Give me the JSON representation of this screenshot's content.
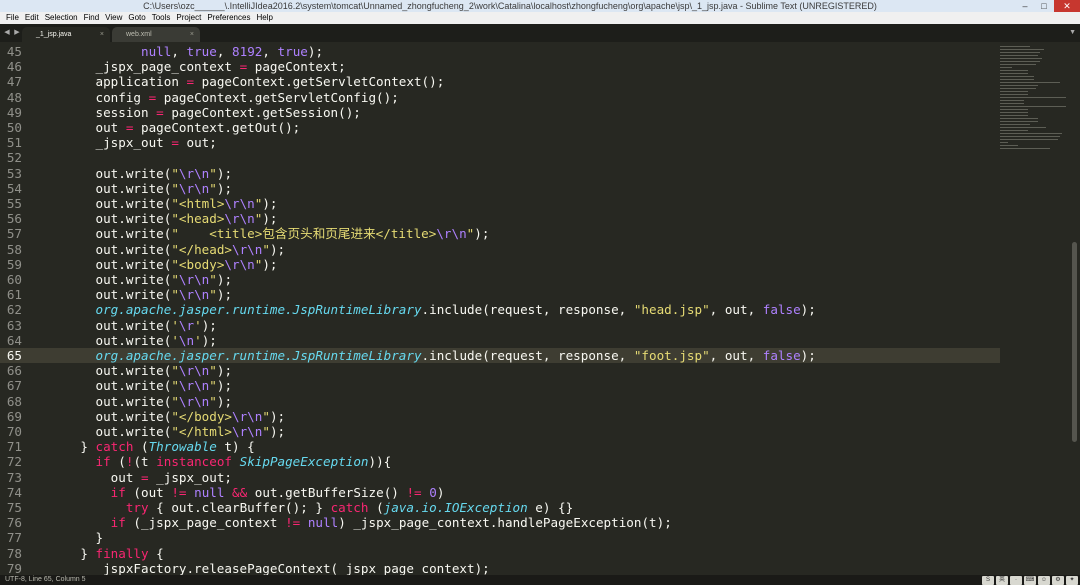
{
  "window": {
    "title": "C:\\Users\\ozc______\\.IntelliJIdea2016.2\\system\\tomcat\\Unnamed_zhongfucheng_2\\work\\Catalina\\localhost\\zhongfucheng\\org\\apache\\jsp\\_1_jsp.java - Sublime Text (UNREGISTERED)",
    "controls": {
      "minimize": "–",
      "maximize": "□",
      "close": "✕"
    }
  },
  "menu": [
    "File",
    "Edit",
    "Selection",
    "Find",
    "View",
    "Goto",
    "Tools",
    "Project",
    "Preferences",
    "Help"
  ],
  "tabs": [
    {
      "label": "_1_jsp.java",
      "active": true,
      "close": "×"
    },
    {
      "label": "web.xml",
      "active": false,
      "close": "×"
    }
  ],
  "nav": {
    "left": "◀",
    "right": "▶",
    "drop": "▼"
  },
  "editor": {
    "current_line": "65",
    "lines": [
      {
        "n": "45",
        "tokens": [
          [
            "",
            "            "
          ],
          [
            "c",
            "null"
          ],
          [
            "",
            ", "
          ],
          [
            "c",
            "true"
          ],
          [
            "",
            ", "
          ],
          [
            "c",
            "8192"
          ],
          [
            "",
            ", "
          ],
          [
            "c",
            "true"
          ],
          [
            "",
            ");"
          ]
        ]
      },
      {
        "n": "46",
        "tokens": [
          [
            "",
            "      _jspx_page_context "
          ],
          [
            "k",
            "="
          ],
          [
            "",
            " pageContext;"
          ]
        ]
      },
      {
        "n": "47",
        "tokens": [
          [
            "",
            "      application "
          ],
          [
            "k",
            "="
          ],
          [
            "",
            " pageContext.getServletContext();"
          ]
        ]
      },
      {
        "n": "48",
        "tokens": [
          [
            "",
            "      config "
          ],
          [
            "k",
            "="
          ],
          [
            "",
            " pageContext.getServletConfig();"
          ]
        ]
      },
      {
        "n": "49",
        "tokens": [
          [
            "",
            "      session "
          ],
          [
            "k",
            "="
          ],
          [
            "",
            " pageContext.getSession();"
          ]
        ]
      },
      {
        "n": "50",
        "tokens": [
          [
            "",
            "      out "
          ],
          [
            "k",
            "="
          ],
          [
            "",
            " pageContext.getOut();"
          ]
        ]
      },
      {
        "n": "51",
        "tokens": [
          [
            "",
            "      _jspx_out "
          ],
          [
            "k",
            "="
          ],
          [
            "",
            " out;"
          ]
        ]
      },
      {
        "n": "52",
        "tokens": [
          [
            "",
            ""
          ]
        ]
      },
      {
        "n": "53",
        "tokens": [
          [
            "",
            "      out.write("
          ],
          [
            "s",
            "\""
          ],
          [
            "e",
            "\\r\\n"
          ],
          [
            "s",
            "\""
          ],
          [
            "",
            ");"
          ]
        ]
      },
      {
        "n": "54",
        "tokens": [
          [
            "",
            "      out.write("
          ],
          [
            "s",
            "\""
          ],
          [
            "e",
            "\\r\\n"
          ],
          [
            "s",
            "\""
          ],
          [
            "",
            ");"
          ]
        ]
      },
      {
        "n": "55",
        "tokens": [
          [
            "",
            "      out.write("
          ],
          [
            "s",
            "\"<html>"
          ],
          [
            "e",
            "\\r\\n"
          ],
          [
            "s",
            "\""
          ],
          [
            "",
            ");"
          ]
        ]
      },
      {
        "n": "56",
        "tokens": [
          [
            "",
            "      out.write("
          ],
          [
            "s",
            "\"<head>"
          ],
          [
            "e",
            "\\r\\n"
          ],
          [
            "s",
            "\""
          ],
          [
            "",
            ");"
          ]
        ]
      },
      {
        "n": "57",
        "tokens": [
          [
            "",
            "      out.write("
          ],
          [
            "s",
            "\"    <title>包含页头和页尾进来</title>"
          ],
          [
            "e",
            "\\r\\n"
          ],
          [
            "s",
            "\""
          ],
          [
            "",
            ");"
          ]
        ]
      },
      {
        "n": "58",
        "tokens": [
          [
            "",
            "      out.write("
          ],
          [
            "s",
            "\"</head>"
          ],
          [
            "e",
            "\\r\\n"
          ],
          [
            "s",
            "\""
          ],
          [
            "",
            ");"
          ]
        ]
      },
      {
        "n": "59",
        "tokens": [
          [
            "",
            "      out.write("
          ],
          [
            "s",
            "\"<body>"
          ],
          [
            "e",
            "\\r\\n"
          ],
          [
            "s",
            "\""
          ],
          [
            "",
            ");"
          ]
        ]
      },
      {
        "n": "60",
        "tokens": [
          [
            "",
            "      out.write("
          ],
          [
            "s",
            "\""
          ],
          [
            "e",
            "\\r\\n"
          ],
          [
            "s",
            "\""
          ],
          [
            "",
            ");"
          ]
        ]
      },
      {
        "n": "61",
        "tokens": [
          [
            "",
            "      out.write("
          ],
          [
            "s",
            "\""
          ],
          [
            "e",
            "\\r\\n"
          ],
          [
            "s",
            "\""
          ],
          [
            "",
            ");"
          ]
        ]
      },
      {
        "n": "62",
        "tokens": [
          [
            "",
            "      "
          ],
          [
            "t",
            "org.apache.jasper.runtime.JspRuntimeLibrary"
          ],
          [
            "",
            ".include(request, response, "
          ],
          [
            "s",
            "\"head.jsp\""
          ],
          [
            "",
            ", out, "
          ],
          [
            "c",
            "false"
          ],
          [
            "",
            ");"
          ]
        ]
      },
      {
        "n": "63",
        "tokens": [
          [
            "",
            "      out.write("
          ],
          [
            "s",
            "'"
          ],
          [
            "e",
            "\\r"
          ],
          [
            "s",
            "'"
          ],
          [
            "",
            ");"
          ]
        ]
      },
      {
        "n": "64",
        "tokens": [
          [
            "",
            "      out.write("
          ],
          [
            "s",
            "'"
          ],
          [
            "e",
            "\\n"
          ],
          [
            "s",
            "'"
          ],
          [
            "",
            ");"
          ]
        ]
      },
      {
        "n": "65",
        "tokens": [
          [
            "",
            "      "
          ],
          [
            "t",
            "org.apache.jasper.runtime.JspRuntimeLibrary"
          ],
          [
            "",
            ".include(request, response, "
          ],
          [
            "s",
            "\"foot.jsp\""
          ],
          [
            "",
            ", out, "
          ],
          [
            "c",
            "false"
          ],
          [
            "",
            ");"
          ]
        ]
      },
      {
        "n": "66",
        "tokens": [
          [
            "",
            "      out.write("
          ],
          [
            "s",
            "\""
          ],
          [
            "e",
            "\\r\\n"
          ],
          [
            "s",
            "\""
          ],
          [
            "",
            ");"
          ]
        ]
      },
      {
        "n": "67",
        "tokens": [
          [
            "",
            "      out.write("
          ],
          [
            "s",
            "\""
          ],
          [
            "e",
            "\\r\\n"
          ],
          [
            "s",
            "\""
          ],
          [
            "",
            ");"
          ]
        ]
      },
      {
        "n": "68",
        "tokens": [
          [
            "",
            "      out.write("
          ],
          [
            "s",
            "\""
          ],
          [
            "e",
            "\\r\\n"
          ],
          [
            "s",
            "\""
          ],
          [
            "",
            ");"
          ]
        ]
      },
      {
        "n": "69",
        "tokens": [
          [
            "",
            "      out.write("
          ],
          [
            "s",
            "\"</body>"
          ],
          [
            "e",
            "\\r\\n"
          ],
          [
            "s",
            "\""
          ],
          [
            "",
            ");"
          ]
        ]
      },
      {
        "n": "70",
        "tokens": [
          [
            "",
            "      out.write("
          ],
          [
            "s",
            "\"</html>"
          ],
          [
            "e",
            "\\r\\n"
          ],
          [
            "s",
            "\""
          ],
          [
            "",
            ");"
          ]
        ]
      },
      {
        "n": "71",
        "tokens": [
          [
            "",
            "    } "
          ],
          [
            "k",
            "catch"
          ],
          [
            "",
            " ("
          ],
          [
            "t",
            "Throwable"
          ],
          [
            "",
            " t) {"
          ]
        ]
      },
      {
        "n": "72",
        "tokens": [
          [
            "",
            "      "
          ],
          [
            "k",
            "if"
          ],
          [
            "",
            " ("
          ],
          [
            "k",
            "!"
          ],
          [
            "",
            "(t "
          ],
          [
            "k",
            "instanceof"
          ],
          [
            "",
            " "
          ],
          [
            "t",
            "SkipPageException"
          ],
          [
            "",
            ")){"
          ]
        ]
      },
      {
        "n": "73",
        "tokens": [
          [
            "",
            "        out "
          ],
          [
            "k",
            "="
          ],
          [
            "",
            " _jspx_out;"
          ]
        ]
      },
      {
        "n": "74",
        "tokens": [
          [
            "",
            "        "
          ],
          [
            "k",
            "if"
          ],
          [
            "",
            " (out "
          ],
          [
            "k",
            "!="
          ],
          [
            "",
            " "
          ],
          [
            "c",
            "null"
          ],
          [
            "",
            " "
          ],
          [
            "k",
            "&&"
          ],
          [
            "",
            " out.getBufferSize() "
          ],
          [
            "k",
            "!="
          ],
          [
            "",
            " "
          ],
          [
            "c",
            "0"
          ],
          [
            "",
            ")"
          ]
        ]
      },
      {
        "n": "75",
        "tokens": [
          [
            "",
            "          "
          ],
          [
            "k",
            "try"
          ],
          [
            "",
            " { out.clearBuffer(); } "
          ],
          [
            "k",
            "catch"
          ],
          [
            "",
            " ("
          ],
          [
            "t",
            "java.io.IOException"
          ],
          [
            "",
            " e) {}"
          ]
        ]
      },
      {
        "n": "76",
        "tokens": [
          [
            "",
            "        "
          ],
          [
            "k",
            "if"
          ],
          [
            "",
            " (_jspx_page_context "
          ],
          [
            "k",
            "!="
          ],
          [
            "",
            " "
          ],
          [
            "c",
            "null"
          ],
          [
            "",
            ") _jspx_page_context.handlePageException(t);"
          ]
        ]
      },
      {
        "n": "77",
        "tokens": [
          [
            "",
            "      }"
          ]
        ]
      },
      {
        "n": "78",
        "tokens": [
          [
            "",
            "    } "
          ],
          [
            "k",
            "finally"
          ],
          [
            "",
            " {"
          ]
        ]
      },
      {
        "n": "79",
        "tokens": [
          [
            "",
            "      _jspxFactory.releasePageContext(_jspx_page_context);"
          ]
        ]
      }
    ]
  },
  "status": {
    "text": "UTF-8, Line 65, Column 5"
  },
  "tray": [
    "S",
    "英",
    "·",
    "⌨",
    "☺",
    "⚙",
    "✦"
  ],
  "colors": {
    "background": "#272822",
    "string": "#e6db74",
    "keyword": "#f92672",
    "constant": "#ae81ff",
    "type": "#66d9ef",
    "current_line": "#3e3d32"
  }
}
